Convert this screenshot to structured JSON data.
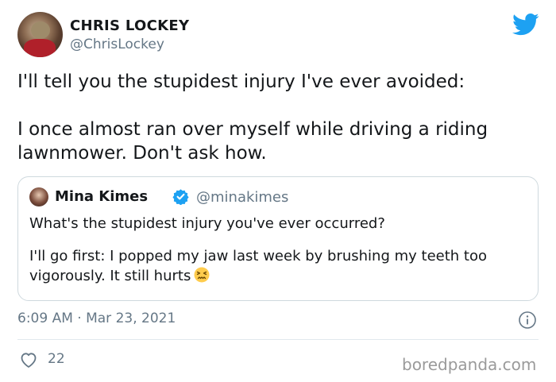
{
  "author": {
    "display_name": "CHRIS LOCKEY",
    "handle": "@ChrisLockey"
  },
  "tweet": {
    "line1": "I'll tell you the stupidest injury I've ever avoided:",
    "line2": "I once almost ran over myself while driving a riding lawnmower. Don't ask how."
  },
  "quoted_tweet": {
    "display_name": "Mina Kimes",
    "handle": "@minakimes",
    "line1": "What's the stupidest injury you've ever occurred?",
    "line2": "I'll go first: I popped my jaw last week by brushing my teeth too vigorously. It still hurts",
    "verified": true
  },
  "meta": {
    "timestamp": "6:09 AM · Mar 23, 2021",
    "likes": "22"
  },
  "watermark": "boredpanda.com",
  "icons": {
    "bird": "twitter-bird-icon",
    "verified": "verified-badge-icon",
    "emoji": "confounded-face-emoji",
    "info": "info-icon",
    "like": "heart-icon"
  },
  "colors": {
    "twitter_blue": "#1da1f2",
    "secondary_text": "#657786",
    "border": "#cfd9de"
  }
}
